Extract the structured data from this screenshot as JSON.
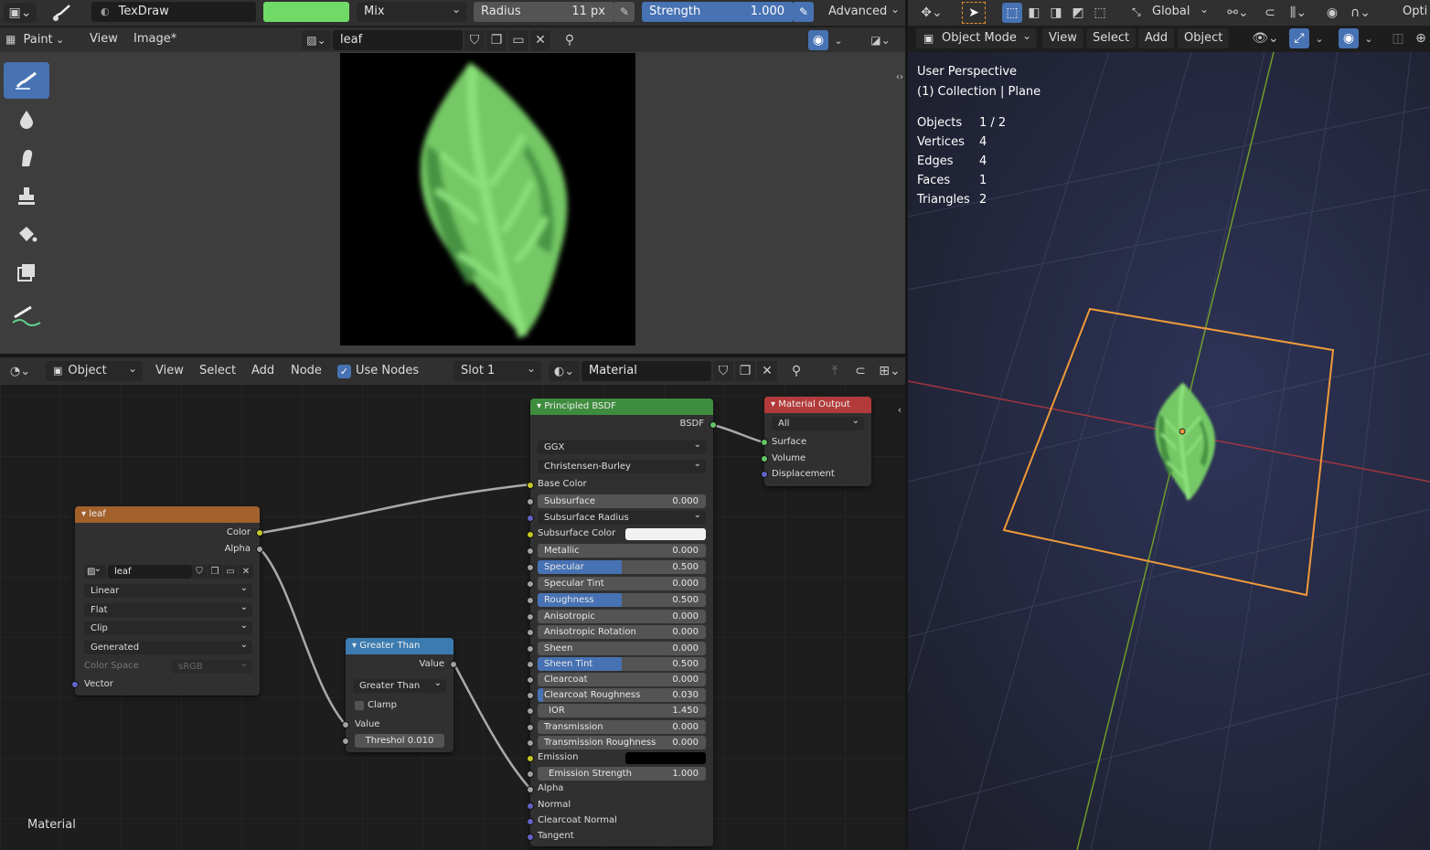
{
  "top_header": {
    "brush_name": "TexDraw",
    "color_hex": "#6fda66",
    "blend_mode": "Mix",
    "radius_label": "Radius",
    "radius_value": "11 px",
    "strength_label": "Strength",
    "strength_value": "1.000",
    "advanced_label": "Advanced"
  },
  "image_editor": {
    "mode_label": "Paint",
    "menu": [
      "View",
      "Image*"
    ],
    "image_name": "leaf"
  },
  "node_editor": {
    "type_label": "Object",
    "menu": [
      "View",
      "Select",
      "Add",
      "Node"
    ],
    "use_nodes_label": "Use Nodes",
    "slot_label": "Slot 1",
    "material_name": "Material",
    "corner_label": "Material"
  },
  "node_leaf": {
    "title": "leaf",
    "outputs": [
      "Color",
      "Alpha"
    ],
    "image_name": "leaf",
    "interpolation": "Linear",
    "projection": "Flat",
    "extension": "Clip",
    "source": "Generated",
    "color_space_label": "Color Space",
    "color_space_value": "sRGB",
    "input_vector": "Vector"
  },
  "node_greater": {
    "title": "Greater Than",
    "output": "Value",
    "operation": "Greater Than",
    "clamp_label": "Clamp",
    "input_value": "Value",
    "threshold_label": "Threshol",
    "threshold_value": "0.010"
  },
  "node_bsdf": {
    "title": "Principled BSDF",
    "output": "BSDF",
    "distribution": "GGX",
    "subsurface_method": "Christensen-Burley",
    "base_color": "Base Color",
    "subsurface": {
      "label": "Subsurface",
      "value": "0.000"
    },
    "subsurface_radius": "Subsurface Radius",
    "subsurface_color": "Subsurface Color",
    "metallic": {
      "label": "Metallic",
      "value": "0.000"
    },
    "specular": {
      "label": "Specular",
      "value": "0.500",
      "fraction": 0.5
    },
    "specular_tint": {
      "label": "Specular Tint",
      "value": "0.000"
    },
    "roughness": {
      "label": "Roughness",
      "value": "0.500",
      "fraction": 0.5
    },
    "anisotropic": {
      "label": "Anisotropic",
      "value": "0.000"
    },
    "anisotropic_rotation": {
      "label": "Anisotropic Rotation",
      "value": "0.000"
    },
    "sheen": {
      "label": "Sheen",
      "value": "0.000"
    },
    "sheen_tint": {
      "label": "Sheen Tint",
      "value": "0.500",
      "fraction": 0.5
    },
    "clearcoat": {
      "label": "Clearcoat",
      "value": "0.000"
    },
    "clearcoat_roughness": {
      "label": "Clearcoat Roughness",
      "value": "0.030",
      "fraction": 0.03
    },
    "ior": {
      "label": "IOR",
      "value": "1.450"
    },
    "transmission": {
      "label": "Transmission",
      "value": "0.000"
    },
    "transmission_roughness": {
      "label": "Transmission Roughness",
      "value": "0.000"
    },
    "emission": "Emission",
    "emission_strength": {
      "label": "Emission Strength",
      "value": "1.000"
    },
    "alpha": "Alpha",
    "normal": "Normal",
    "clearcoat_normal": "Clearcoat Normal",
    "tangent": "Tangent"
  },
  "node_output": {
    "title": "Material Output",
    "target": "All",
    "inputs": [
      "Surface",
      "Volume",
      "Displacement"
    ]
  },
  "viewport": {
    "transform_orientation": "Global",
    "overlay_label": "Opti",
    "mode_label": "Object Mode",
    "menu": [
      "View",
      "Select",
      "Add",
      "Object"
    ],
    "perspective": "User Perspective",
    "collection": "(1) Collection | Plane",
    "stats": [
      {
        "label": "Objects",
        "value": "1 / 2"
      },
      {
        "label": "Vertices",
        "value": "4"
      },
      {
        "label": "Edges",
        "value": "4"
      },
      {
        "label": "Faces",
        "value": "1"
      },
      {
        "label": "Triangles",
        "value": "2"
      }
    ]
  },
  "colors": {
    "accent": "#4772b3",
    "leaf_light": "#74c865",
    "leaf_dark": "#3f8a3c",
    "leaf_vein": "#8be07a",
    "node_image_header": "#a2602b",
    "node_math_header": "#3b7bb0",
    "node_shader_header": "#3e8c3e",
    "node_output_header": "#b33a3a",
    "selection_outline": "#f09a3a"
  }
}
